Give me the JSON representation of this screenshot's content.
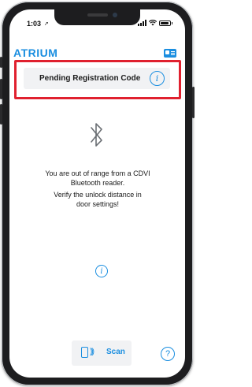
{
  "status_bar": {
    "time": "1:03",
    "location_arrow": "➚"
  },
  "header": {
    "logo_text": "ATRIUM",
    "brand_color": "#1a8ee0",
    "card_icon": "credential-card-icon"
  },
  "pending": {
    "label": "Pending Registration Code",
    "info_icon": "i",
    "highlight_color": "#e0212f"
  },
  "message": {
    "line1": "You are out of range from a CDVI",
    "line2": "Bluetooth reader.",
    "line3": "Verify the unlock distance in",
    "line4": "door settings!"
  },
  "info_button": {
    "icon": "i"
  },
  "footer": {
    "scan_label": "Scan",
    "scan_waves": ")))",
    "help_icon": "?"
  }
}
